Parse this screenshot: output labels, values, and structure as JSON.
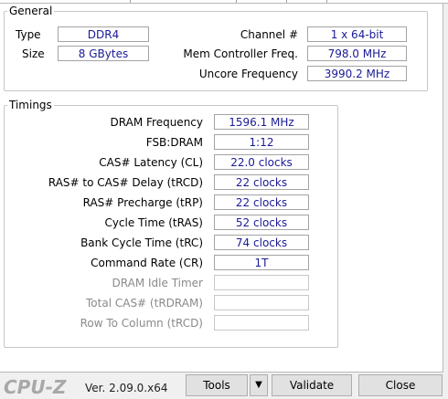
{
  "general": {
    "title": "General",
    "type_label": "Type",
    "type_value": "DDR4",
    "size_label": "Size",
    "size_value": "8 GBytes",
    "channel_label": "Channel #",
    "channel_value": "1 x 64-bit",
    "mem_ctrl_label": "Mem Controller Freq.",
    "mem_ctrl_value": "798.0 MHz",
    "uncore_label": "Uncore Frequency",
    "uncore_value": "3990.2 MHz"
  },
  "timings": {
    "title": "Timings",
    "rows": [
      {
        "label": "DRAM Frequency",
        "value": "1596.1 MHz",
        "enabled": true
      },
      {
        "label": "FSB:DRAM",
        "value": "1:12",
        "enabled": true
      },
      {
        "label": "CAS# Latency (CL)",
        "value": "22.0 clocks",
        "enabled": true
      },
      {
        "label": "RAS# to CAS# Delay (tRCD)",
        "value": "22 clocks",
        "enabled": true
      },
      {
        "label": "RAS# Precharge (tRP)",
        "value": "22 clocks",
        "enabled": true
      },
      {
        "label": "Cycle Time (tRAS)",
        "value": "52 clocks",
        "enabled": true
      },
      {
        "label": "Bank Cycle Time (tRC)",
        "value": "74 clocks",
        "enabled": true
      },
      {
        "label": "Command Rate (CR)",
        "value": "1T",
        "enabled": true
      },
      {
        "label": "DRAM Idle Timer",
        "value": "",
        "enabled": false
      },
      {
        "label": "Total CAS# (tRDRAM)",
        "value": "",
        "enabled": false
      },
      {
        "label": "Row To Column (tRCD)",
        "value": "",
        "enabled": false
      }
    ]
  },
  "footer": {
    "logo": "CPU-Z",
    "version": "Ver. 2.09.0.x64",
    "tools_label": "Tools",
    "tools_dropdown": "▼",
    "validate_label": "Validate",
    "close_label": "Close"
  },
  "colors": {
    "value_text": "#1a1a96",
    "disabled_text": "#8a8a8a",
    "logo_text": "#a8a8a8"
  }
}
